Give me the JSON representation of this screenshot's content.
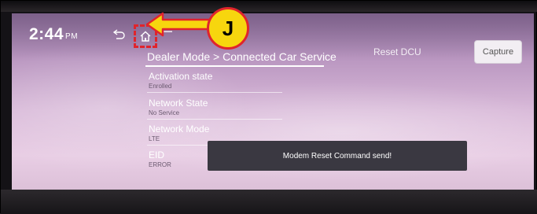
{
  "status_bar": {
    "time": "2:44",
    "ampm": "PM"
  },
  "breadcrumb": "Dealer Mode > Connected Car Service",
  "reset_dcu_label": "Reset DCU",
  "capture_label": "Capture",
  "callout_label": "J",
  "info_items": [
    {
      "label": "Activation state",
      "value": "Enrolled"
    },
    {
      "label": "Network State",
      "value": "No Service"
    },
    {
      "label": "Network Mode",
      "value": "LTE"
    },
    {
      "label": "EID",
      "value": "ERROR"
    }
  ],
  "toast_message": "Modem Reset Command send!",
  "colors": {
    "callout_fill": "#f7d60e",
    "callout_outline": "#e0242c",
    "highlight_box": "#e0242c",
    "toast_background": "#3a3841"
  },
  "icons": [
    "back-icon",
    "home-icon",
    "menu-icon",
    "arrow-left-icon"
  ]
}
